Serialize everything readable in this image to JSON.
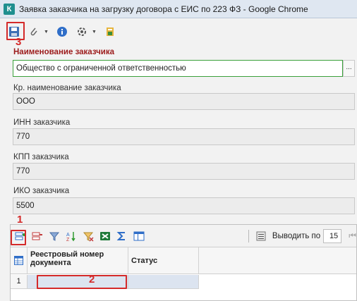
{
  "window": {
    "title": "Заявка заказчика на загрузку договора с ЕИС по 223 ФЗ - Google Chrome",
    "icon_letter": "К"
  },
  "toolbar": {
    "icons": [
      "save-icon",
      "paperclip-icon",
      "info-icon",
      "gear-icon",
      "book-icon"
    ],
    "annotation_3": "3"
  },
  "form": {
    "name_label": "Наименование заказчика",
    "name_value": "Общество с ограниченной ответственностью",
    "ellipsis": "...",
    "short_name_label": "Кр. наименование заказчика",
    "short_name_value": "ООО",
    "inn_label": "ИНН заказчика",
    "inn_value": "770",
    "kpp_label": "КПП заказчика",
    "kpp_value": "770",
    "iko_label": "ИКО заказчика",
    "iko_value": "5500"
  },
  "grid": {
    "annotation_1": "1",
    "annotation_2": "2",
    "toolbar_icons": [
      "add-row-icon",
      "delete-row-icon",
      "filter-icon",
      "sort-az-icon",
      "filter-clear-icon",
      "excel-icon",
      "sum-icon",
      "columns-icon"
    ],
    "per_page_label": "Выводить по",
    "per_page_value": "15",
    "columns": [
      "Реестровый номер документа",
      "Статус"
    ],
    "rows": [
      {
        "num": "1",
        "reg_number": "",
        "status": ""
      }
    ]
  },
  "colors": {
    "highlight": "#d42a2a",
    "required_label": "#9c1b1b",
    "active_border": "#3aa03a"
  }
}
